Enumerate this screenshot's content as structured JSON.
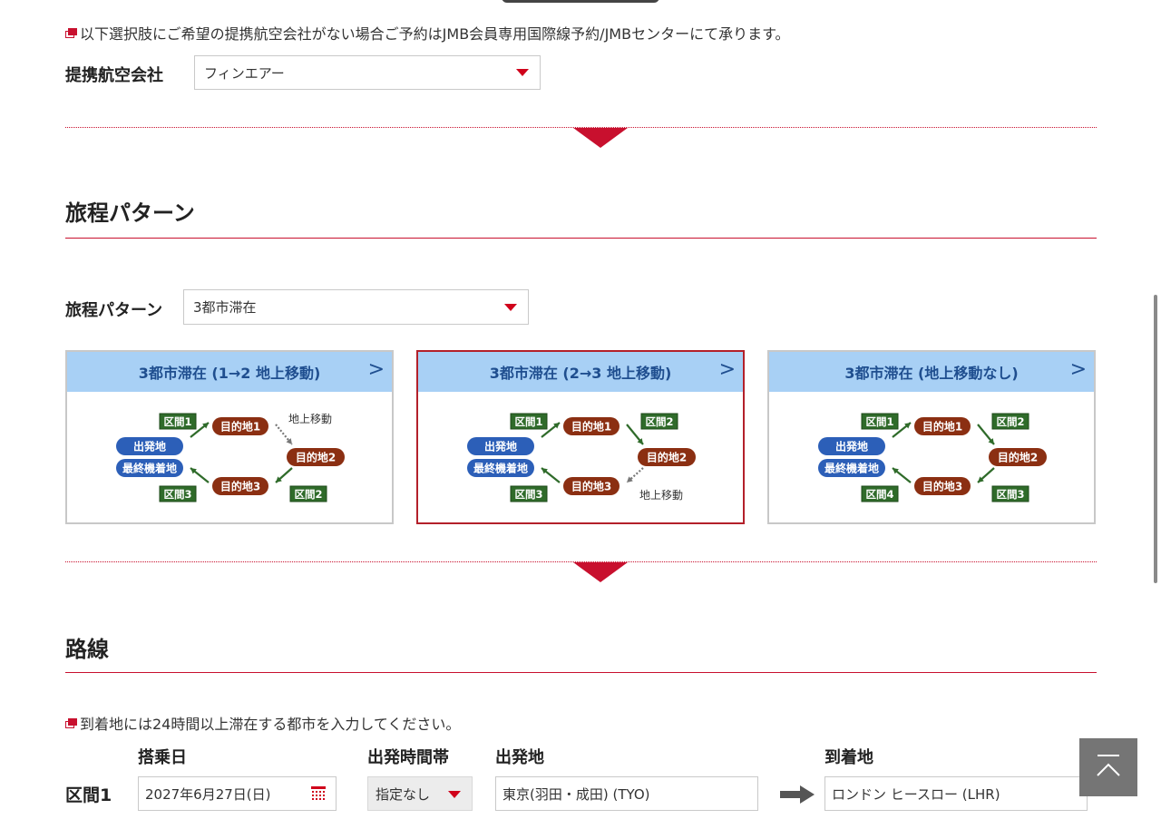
{
  "airline_section": {
    "notice": "以下選択肢にご希望の提携航空会社がない場合ご予約はJMB会員専用国際線予約/JMBセンターにて承ります。",
    "label": "提携航空会社",
    "selected": "フィンエアー"
  },
  "itinerary_section": {
    "title": "旅程パターン",
    "label": "旅程パターン",
    "selected": "3都市滞在",
    "cards": [
      {
        "title": "3都市滞在 (1→2 地上移動)",
        "selected": false,
        "origin": "出発地",
        "final": "最終機着地",
        "dest1": "目的地1",
        "dest2": "目的地2",
        "dest3": "目的地3",
        "seg_a": "区間1",
        "seg_b": "地上移動",
        "seg_c": "区間2",
        "seg_d": "区間3"
      },
      {
        "title": "3都市滞在 (2→3 地上移動)",
        "selected": true,
        "origin": "出発地",
        "final": "最終機着地",
        "dest1": "目的地1",
        "dest2": "目的地2",
        "dest3": "目的地3",
        "seg_a": "区間1",
        "seg_b": "区間2",
        "seg_c": "地上移動",
        "seg_d": "区間3"
      },
      {
        "title": "3都市滞在 (地上移動なし)",
        "selected": false,
        "origin": "出発地",
        "final": "最終機着地",
        "dest1": "目的地1",
        "dest2": "目的地2",
        "dest3": "目的地3",
        "seg_a": "区間1",
        "seg_b": "区間2",
        "seg_c": "区間3",
        "seg_d": "区間4"
      }
    ]
  },
  "route_section": {
    "title": "路線",
    "notice": "到着地には24時間以上滞在する都市を入力してください。",
    "columns": {
      "date": "搭乗日",
      "time": "出発時間帯",
      "origin": "出発地",
      "destination": "到着地"
    },
    "segment1": {
      "label": "区間1",
      "date": "2027年6月27日(日)",
      "time": "指定なし",
      "origin": "東京(羽田・成田) (TYO)",
      "destination": "ロンドン ヒースロー (LHR)"
    }
  },
  "colors": {
    "accent_red": "#c8102e",
    "card_header_blue": "#a8d0f5",
    "origin_blue": "#2c5fb8",
    "dest_brown": "#8b2f12",
    "segment_green": "#2f6b2a"
  },
  "icons": {
    "calendar": "calendar-icon",
    "arrow": "arrow-right-icon",
    "scroll_top": "scroll-to-top-icon",
    "external_link": "external-link-icon"
  }
}
